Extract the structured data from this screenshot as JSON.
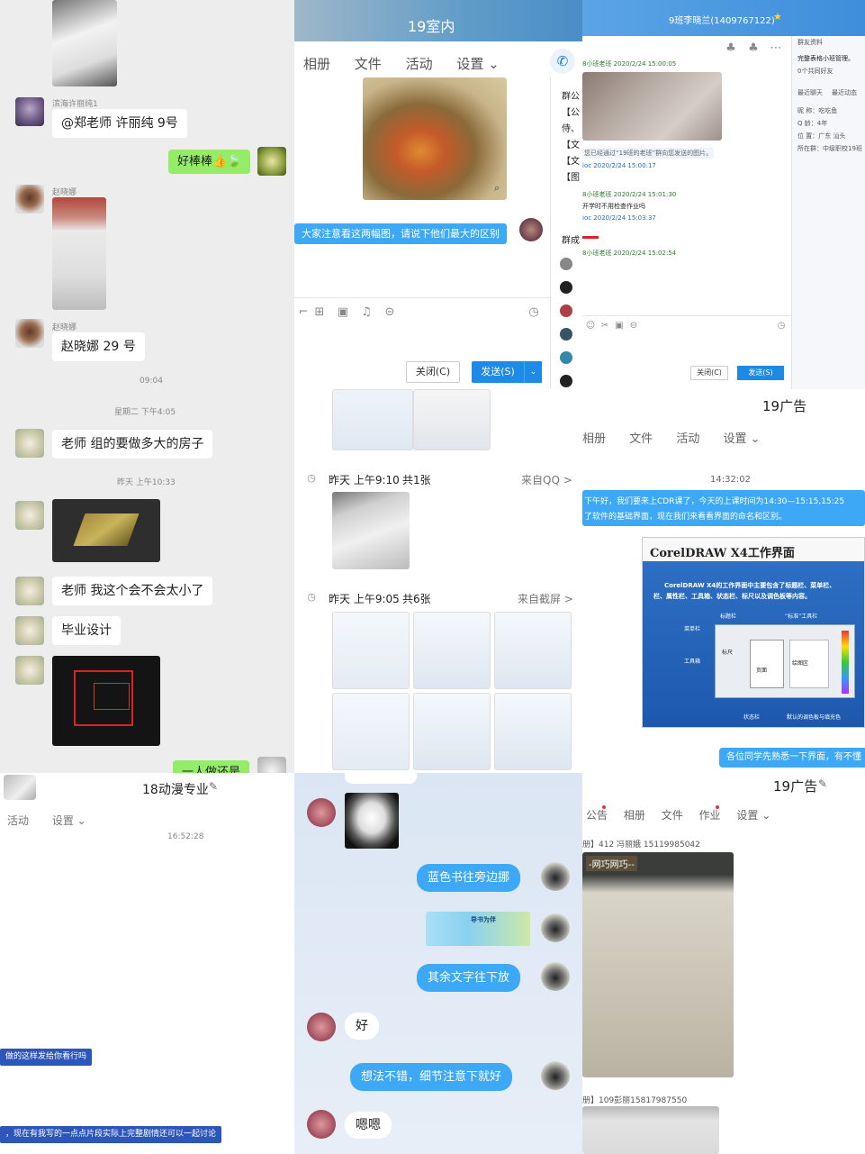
{
  "p1": {
    "sender1": "滨海许丽纯1",
    "msg1": "@郑老师 许丽纯 9号",
    "msg2": "好棒棒👍🍃",
    "sender2": "赵晓娜",
    "sender3": "赵晓娜",
    "msg3": "赵晓娜 29 号",
    "time1": "09:04",
    "time2": "星期二 下午4:05",
    "msg4": "老师 组的要做多大的房子",
    "time3": "昨天 上午10:33",
    "msg5": "老师 我这个会不会太小了",
    "msg6": "毕业设计",
    "msg7": "一人做还是"
  },
  "p2": {
    "title": "19室内",
    "tabs": [
      "相册",
      "文件",
      "活动",
      "设置 ⌄"
    ],
    "side_labels": [
      "群公",
      "【公",
      "侍、",
      "【文",
      "【文",
      "【图"
    ],
    "msg_blue": "大家注意看这两幅图，请说下他们最大的区别",
    "side_label2": "群成",
    "close_btn": "关闭(C)",
    "send_btn": "发送(S)"
  },
  "p3": {
    "title": "9班李晓兰(1409767122)",
    "star_icon": "star-icon",
    "tiny1": "8小班老班 2020/2/24 15:00:05",
    "tiny2": "您已经通过“19班的老班”群向您发送的图片。",
    "tiny3": "ioc 2020/2/24 15:00:17",
    "tiny4": "8小班老班 2020/2/24 15:01:30",
    "tiny5": "开学时不用检查作业吗",
    "tiny6": "ioc 2020/2/24 15:03:37",
    "tiny7": "8小班老班 2020/2/24 15:02:54",
    "side_title": "群友资料",
    "side_line1": "完整表格小班管理。",
    "side_line2": "0个共同好友",
    "side_tab1": "最近聊天",
    "side_tab2": "最近动态",
    "side_info": [
      "昵 称：吃吃鱼",
      "Q 龄：4年",
      "位 置：广东 汕头",
      "所在群：中级职校19班"
    ],
    "close_btn": "关闭(C)",
    "send_btn": "发送(S)"
  },
  "p5": {
    "group1_time": "昨天 上午9:10",
    "group1_count": "共1张",
    "group1_source": "来自QQ >",
    "group2_time": "昨天 上午9:05",
    "group2_count": "共6张",
    "group2_source": "来自截屏 >"
  },
  "p6": {
    "title": "19广告",
    "tabs": [
      "相册",
      "文件",
      "活动",
      "设置 ⌄"
    ],
    "time": "14:32:02",
    "msg_line1": "下午好，我们要来上CDR课了，今天的上课时间为14:30—15:15,15:25",
    "msg_line2": "了软件的基础界面，现在我们来看看界面的命名和区别。",
    "slide_title": "CorelDRAW X4工作界面",
    "slide_text1": "CorelDRAW X4的工作界面中主要包含了标题栏、菜单栏、",
    "slide_text2": "栏、属性栏、工具箱、状态栏、标尺以及调色板等内容。",
    "slide_labels": [
      "标题栏",
      "“标准”工具栏",
      "菜单栏",
      "工具箱",
      "标尺",
      "页面",
      "绘图区",
      "状态栏",
      "默认的调色板与填充色"
    ],
    "bottom_msg": "各位同学先熟悉一下界面，有不懂"
  },
  "p7": {
    "title": "18动漫专业",
    "edit_icon": "pencil-icon",
    "tabs": [
      "活动",
      "设置 ⌄"
    ],
    "time": "16:52:28",
    "msg1": "做的这样发给你看行吗",
    "msg2": "，现在有我写的一点点片段实际上完整剧情还可以一起讨论"
  },
  "p8": {
    "msg1": "蓝色书往旁边挪",
    "sticker_text": "导书为伴",
    "msg2": "其余文字往下放",
    "msg3": "好",
    "msg4": "想法不错，细节注意下就好",
    "msg5": "嗯嗯"
  },
  "p9": {
    "title": "19广告",
    "tabs": [
      "公告",
      "相册",
      "文件",
      "作业",
      "设置 ⌄"
    ],
    "line1": "册】412 冯丽娥 15119985042",
    "line2": "-网巧网巧--",
    "line3": "册】109彭丽15817987550"
  }
}
